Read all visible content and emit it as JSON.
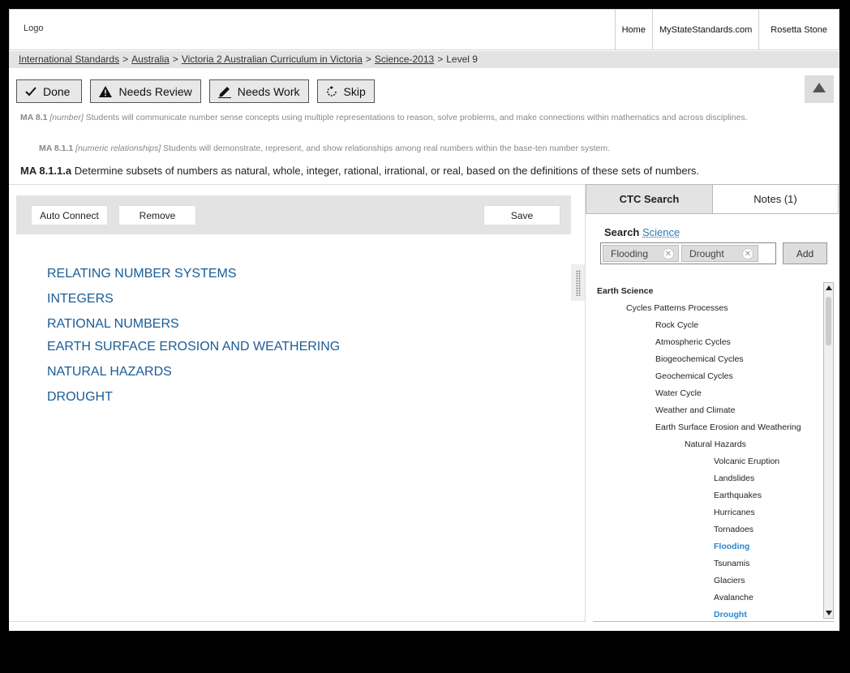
{
  "header": {
    "logo": "Logo",
    "nav": [
      "Home",
      "MyStateStandards.com",
      "Rosetta Stone"
    ]
  },
  "breadcrumb": {
    "links": [
      "International Standards",
      "Australia",
      "Victoria 2 Australian Curriculum in Victoria",
      "Science-2013"
    ],
    "current": "Level 9",
    "separator": ">"
  },
  "actions": {
    "done": "Done",
    "needs_review": "Needs Review",
    "needs_work": "Needs Work",
    "skip": "Skip"
  },
  "standards": {
    "s1_code": "MA 8.1",
    "s1_tag": "[number]",
    "s1_text": "Students will communicate number sense concepts using multiple representations to reason, solve problems, and make connections within mathematics and across disciplines.",
    "s2_code": "MA 8.1.1",
    "s2_tag": "[numeric relationships]",
    "s2_text": "Students will demonstrate, represent, and show relationships among real numbers within the base-ten number system.",
    "s3_code": "MA 8.1.1.a",
    "s3_text": "Determine subsets of numbers as natural, whole, integer, rational, irrational, or real, based on the definitions of these sets of numbers."
  },
  "toolbar": {
    "auto_connect": "Auto Connect",
    "remove": "Remove",
    "save": "Save"
  },
  "concepts": [
    "RELATING NUMBER SYSTEMS",
    "INTEGERS",
    "RATIONAL NUMBERS",
    "EARTH SURFACE EROSION AND WEATHERING",
    "NATURAL HAZARDS",
    "DROUGHT"
  ],
  "tabs": {
    "ctc_search": "CTC Search",
    "notes": "Notes (1)"
  },
  "search": {
    "label": "Search",
    "scope": "Science",
    "tags": [
      "Flooding",
      "Drought"
    ],
    "add": "Add"
  },
  "tree": [
    {
      "label": "Earth Science",
      "level": 0,
      "highlight": false
    },
    {
      "label": "Cycles Patterns Processes",
      "level": 1,
      "highlight": false
    },
    {
      "label": "Rock Cycle",
      "level": 2,
      "highlight": false
    },
    {
      "label": "Atmospheric Cycles",
      "level": 2,
      "highlight": false
    },
    {
      "label": "Biogeochemical Cycles",
      "level": 2,
      "highlight": false
    },
    {
      "label": "Geochemical Cycles",
      "level": 2,
      "highlight": false
    },
    {
      "label": "Water Cycle",
      "level": 2,
      "highlight": false
    },
    {
      "label": "Weather and Climate",
      "level": 2,
      "highlight": false
    },
    {
      "label": "Earth Surface Erosion and Weathering",
      "level": 2,
      "highlight": false
    },
    {
      "label": "Natural Hazards",
      "level": 3,
      "highlight": false
    },
    {
      "label": "Volcanic Eruption",
      "level": 4,
      "highlight": false
    },
    {
      "label": "Landslides",
      "level": 4,
      "highlight": false
    },
    {
      "label": "Earthquakes",
      "level": 4,
      "highlight": false
    },
    {
      "label": "Hurricanes",
      "level": 4,
      "highlight": false
    },
    {
      "label": "Tornadoes",
      "level": 4,
      "highlight": false
    },
    {
      "label": "Flooding",
      "level": 4,
      "highlight": true
    },
    {
      "label": "Tsunamis",
      "level": 4,
      "highlight": false
    },
    {
      "label": "Glaciers",
      "level": 4,
      "highlight": false
    },
    {
      "label": "Avalanche",
      "level": 4,
      "highlight": false
    },
    {
      "label": "Drought",
      "level": 4,
      "highlight": true
    }
  ],
  "icons": {
    "done": "check-icon",
    "needs_review": "warning-icon",
    "needs_work": "pencil-icon",
    "skip": "refresh-icon",
    "scroll_top": "arrow-up-icon",
    "tag_remove": "close-icon"
  },
  "colors": {
    "concept_link": "#1a5c97",
    "highlight": "#2a86d0",
    "panel_gray": "#e3e3e3"
  }
}
